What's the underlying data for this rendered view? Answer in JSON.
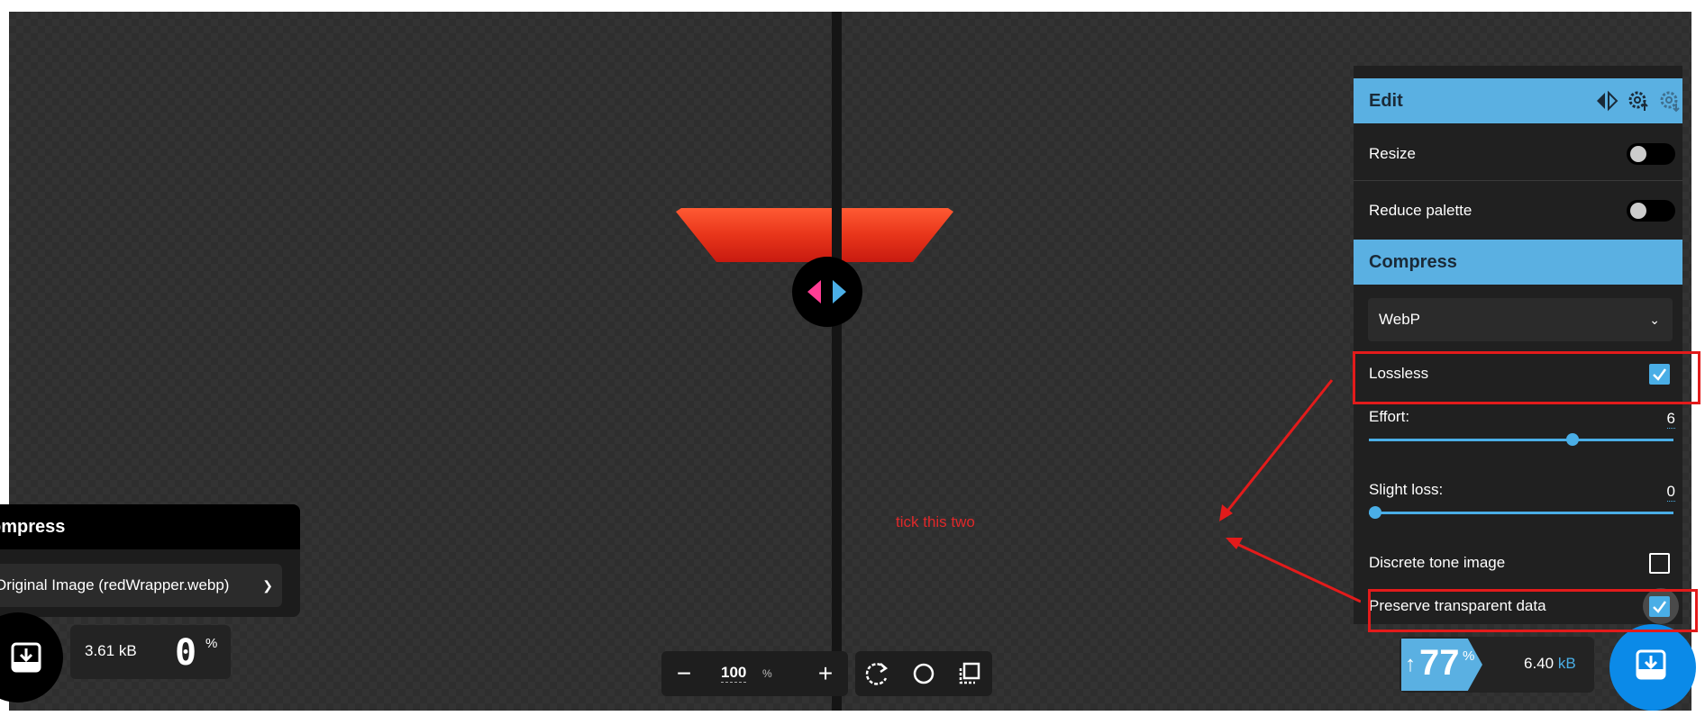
{
  "annotation": {
    "note": "tick this two"
  },
  "left_panel": {
    "title": "ompress",
    "select_value": "Original Image (redWrapper.webp)",
    "size_value": "3.61",
    "size_unit": "kB",
    "percent": "0",
    "percent_sign": "%"
  },
  "zoom": {
    "minus": "−",
    "value": "100",
    "unit": "%",
    "plus": "+"
  },
  "right_panel": {
    "edit_title": "Edit",
    "resize_label": "Resize",
    "reduce_palette_label": "Reduce palette",
    "compress_title": "Compress",
    "format_value": "WebP",
    "lossless_label": "Lossless",
    "effort_label": "Effort:",
    "effort_value": "6",
    "effort_level": 0.67,
    "slight_loss_label": "Slight loss:",
    "slight_loss_value": "0",
    "slight_loss_level": 0.0,
    "discrete_tone_label": "Discrete tone image",
    "preserve_transparent_label": "Preserve transparent data",
    "resize_enabled": false,
    "reduce_palette_enabled": false,
    "lossless_checked": true,
    "discrete_tone_checked": false,
    "preserve_transparent_checked": true
  },
  "result": {
    "arrow": "↑",
    "percent": "77",
    "percent_sign": "%",
    "size_value": "6.40",
    "size_unit": "kB"
  },
  "colors": {
    "accent": "#5ab0e2",
    "annotation_red": "#e31b1b",
    "image_red": "#e8351a"
  }
}
